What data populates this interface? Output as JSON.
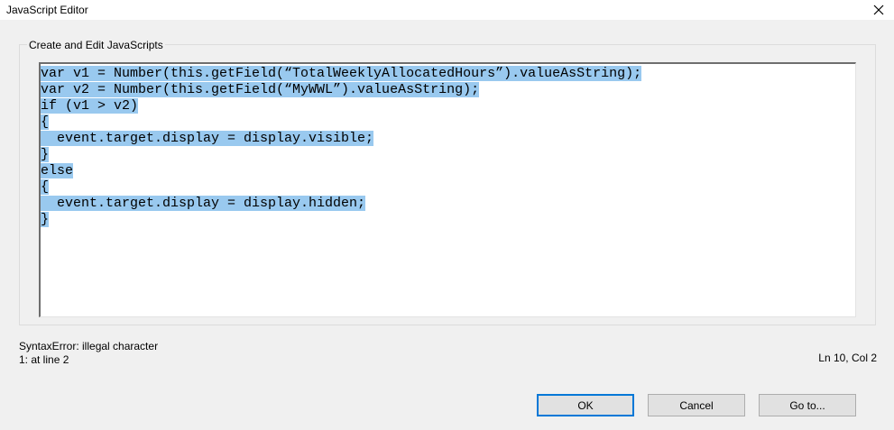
{
  "window": {
    "title": "JavaScript Editor"
  },
  "group": {
    "label": "Create and Edit JavaScripts"
  },
  "editor": {
    "lines": [
      "var v1 = Number(this.getField(“TotalWeeklyAllocatedHours”).valueAsString);",
      "var v2 = Number(this.getField(“MyWWL”).valueAsString);",
      "if (v1 > v2)",
      "{",
      "  event.target.display = display.visible;",
      "}",
      "else",
      "{",
      "  event.target.display = display.hidden;",
      "}"
    ]
  },
  "status": {
    "error_message": "SyntaxError: illegal character",
    "error_location": "1: at line 2",
    "cursor_position": "Ln 10, Col 2"
  },
  "buttons": {
    "ok": "OK",
    "cancel": "Cancel",
    "goto": "Go to..."
  },
  "colors": {
    "selection": "#99c9ef",
    "default_button_border": "#0078d7",
    "background": "#f0f0f0"
  }
}
